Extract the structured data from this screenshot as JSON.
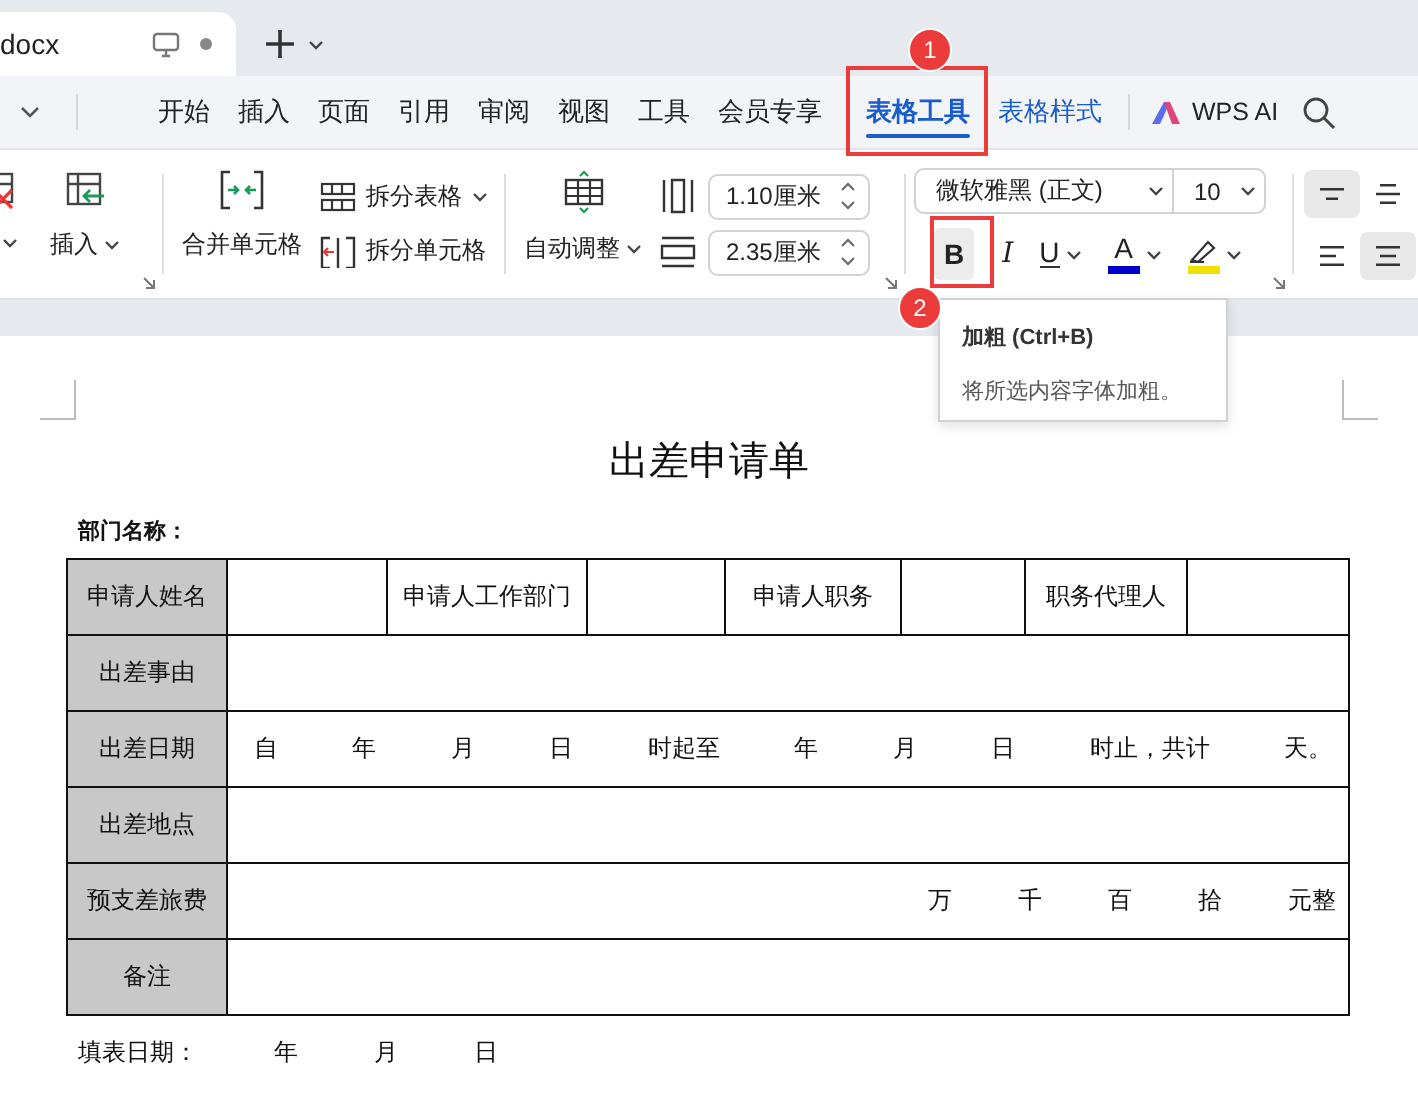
{
  "tab": {
    "title": "docx"
  },
  "menu": [
    {
      "label": "开始",
      "kind": "normal",
      "selected": false
    },
    {
      "label": "插入",
      "kind": "normal",
      "selected": false
    },
    {
      "label": "页面",
      "kind": "normal",
      "selected": false
    },
    {
      "label": "引用",
      "kind": "normal",
      "selected": false
    },
    {
      "label": "审阅",
      "kind": "normal",
      "selected": false
    },
    {
      "label": "视图",
      "kind": "normal",
      "selected": false
    },
    {
      "label": "工具",
      "kind": "normal",
      "selected": false
    },
    {
      "label": "会员专享",
      "kind": "normal",
      "selected": false
    },
    {
      "label": "表格工具",
      "kind": "context",
      "selected": true
    },
    {
      "label": "表格样式",
      "kind": "context",
      "selected": false
    }
  ],
  "ai": {
    "label": "WPS AI"
  },
  "ribbon": {
    "table_buttons": [
      {
        "kind": "delete"
      },
      {
        "kind": "insert",
        "label": "插入"
      }
    ],
    "merge": {
      "label": "合并单元格"
    },
    "split_buttons": [
      {
        "kind": "table",
        "label": "拆分表格"
      },
      {
        "kind": "cells",
        "label": "拆分单元格"
      }
    ],
    "autofit": {
      "label": "自动调整"
    },
    "spin_fields": [
      {
        "kind": "height",
        "value": "1.10厘米"
      },
      {
        "kind": "width",
        "value": "2.35厘米"
      }
    ],
    "font": {
      "value": "微软雅黑 (正文)"
    },
    "size": {
      "value": "10"
    },
    "format_buttons": [
      {
        "kind": "bold",
        "label": "B",
        "hovered": true
      },
      {
        "kind": "italic",
        "label": "I",
        "hovered": false
      },
      {
        "kind": "underline",
        "label": "U",
        "hovered": false
      },
      {
        "kind": "font-color",
        "label": "A",
        "color": "#0000cc",
        "hovered": false
      },
      {
        "kind": "highlight",
        "color": "#f0e000",
        "hovered": false
      }
    ],
    "align_buttons": [
      {
        "kind": "top",
        "selected": true
      },
      {
        "kind": "middle",
        "selected": false
      },
      {
        "kind": "left",
        "selected": false
      },
      {
        "kind": "center",
        "selected": true
      }
    ]
  },
  "tooltip": {
    "title": "加粗 (Ctrl+B)",
    "text": "将所选内容字体加粗。"
  },
  "callouts": [
    {
      "number": "1"
    },
    {
      "number": "2"
    }
  ],
  "document": {
    "title": "出差申请单",
    "department_label": "部门名称：",
    "rows": [
      {
        "kind": "pairs",
        "cells": [
          "申请人姓名",
          "申请人工作部门",
          "申请人职务",
          "职务代理人"
        ]
      },
      {
        "kind": "blank",
        "label": "出差事由"
      },
      {
        "kind": "spread",
        "label": "出差日期",
        "parts": [
          "自",
          "年",
          "月",
          "日",
          "时起至",
          "年",
          "月",
          "日",
          "时止，共计",
          "天。"
        ]
      },
      {
        "kind": "blank",
        "label": "出差地点"
      },
      {
        "kind": "amount",
        "label": "预支差旅费",
        "parts": [
          "万",
          "千",
          "百",
          "拾",
          "元整"
        ]
      },
      {
        "kind": "blank",
        "label": "备注"
      }
    ],
    "footer": [
      "填表日期：",
      "年",
      "月",
      "日"
    ]
  }
}
